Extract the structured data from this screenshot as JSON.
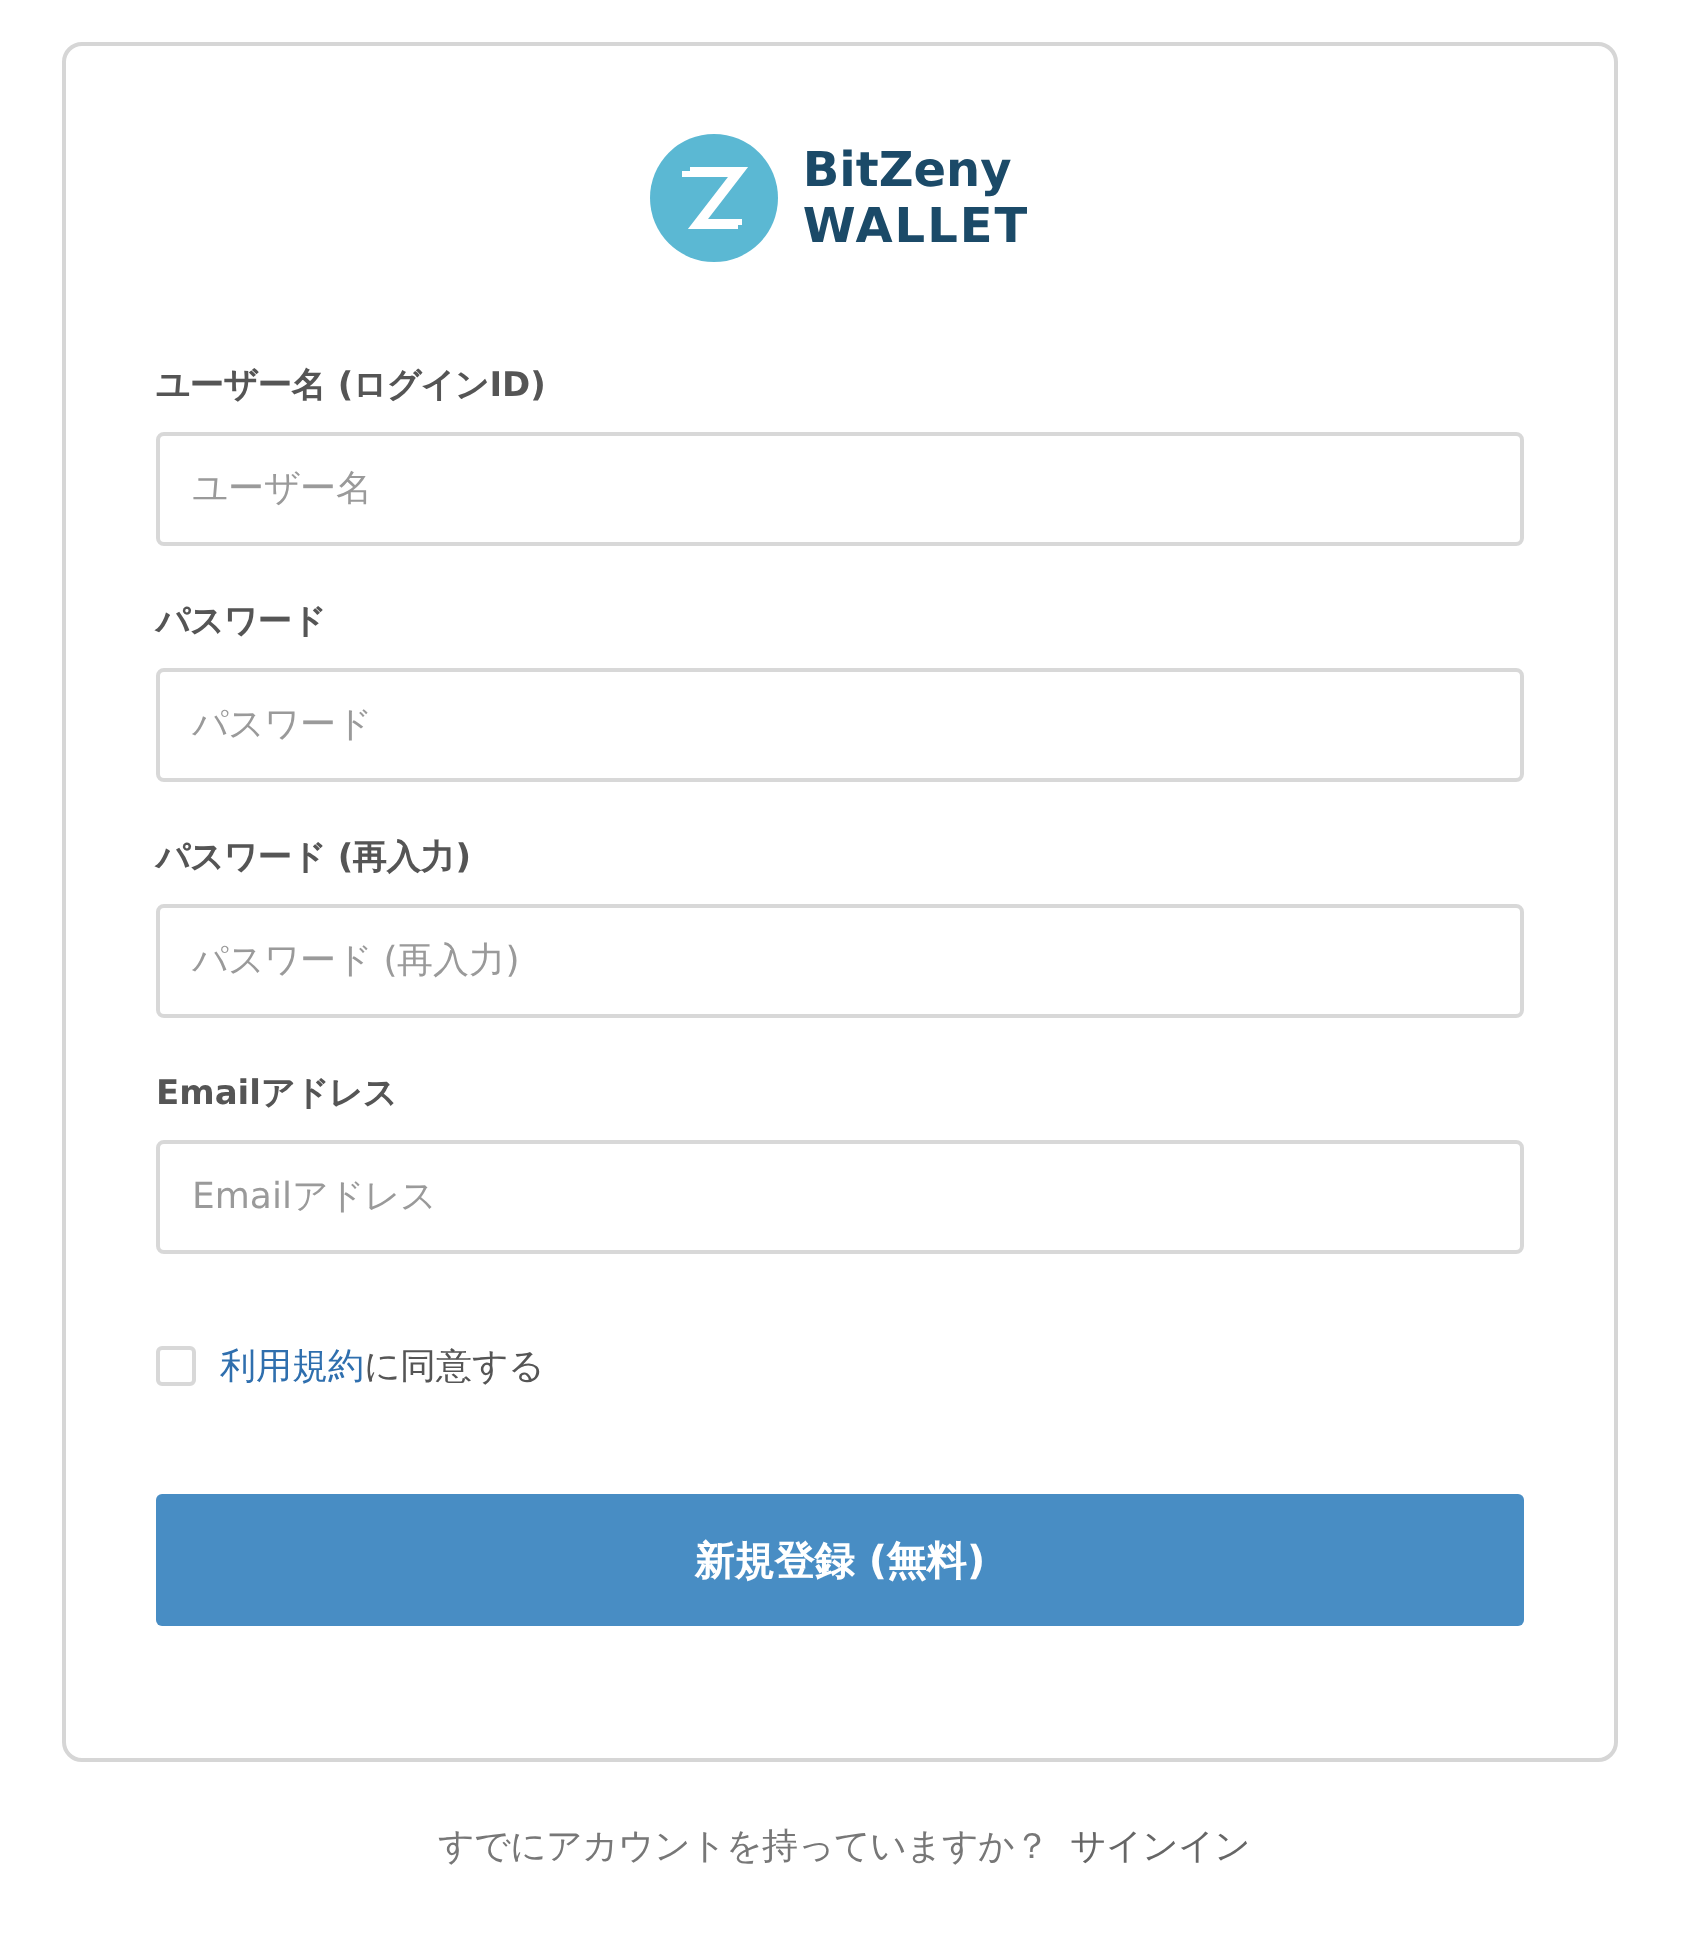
{
  "logo": {
    "line_1": "BitZeny",
    "line_2": "WALLET"
  },
  "fields": [
    {
      "label": "ユーザー名 (ログインID)",
      "placeholder": "ユーザー名"
    },
    {
      "label": "パスワード",
      "placeholder": "パスワード"
    },
    {
      "label": "パスワード (再入力)",
      "placeholder": "パスワード (再入力)"
    },
    {
      "label": "Emailアドレス",
      "placeholder": "Emailアドレス"
    }
  ],
  "agreement": {
    "checked": false,
    "link": "利用規約",
    "text": "に同意する"
  },
  "submit_button": "新規登録 (無料)",
  "footer": {
    "text": "すでにアカウントを持っていますか？",
    "link": "サインイン"
  }
}
